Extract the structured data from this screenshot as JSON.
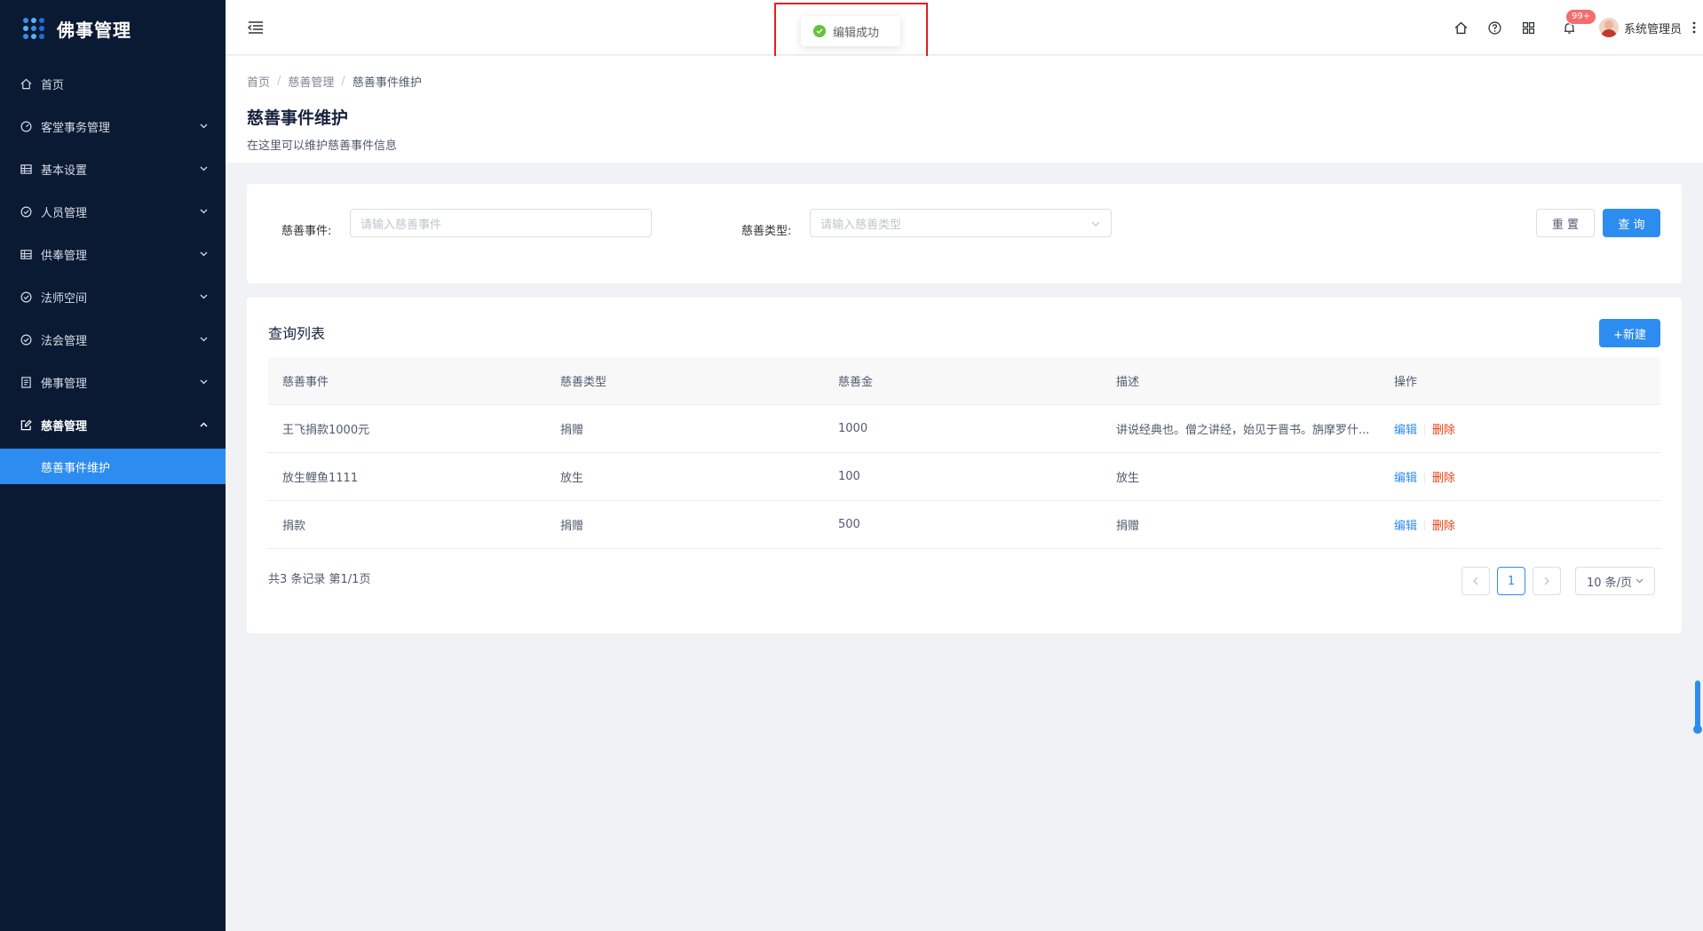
{
  "app": {
    "title": "佛事管理"
  },
  "sidebar": {
    "items": [
      {
        "label": "首页",
        "icon": "home-icon"
      },
      {
        "label": "客堂事务管理",
        "icon": "dashboard-icon"
      },
      {
        "label": "基本设置",
        "icon": "table-icon"
      },
      {
        "label": "人员管理",
        "icon": "check-circle-icon"
      },
      {
        "label": "供奉管理",
        "icon": "table-icon"
      },
      {
        "label": "法师空间",
        "icon": "check-circle-icon"
      },
      {
        "label": "法会管理",
        "icon": "check-circle-icon"
      },
      {
        "label": "佛事管理",
        "icon": "document-icon"
      },
      {
        "label": "慈善管理",
        "icon": "edit-icon"
      }
    ],
    "sub_item": "慈善事件维护"
  },
  "header": {
    "notification_badge": "99+",
    "user_name": "系统管理员"
  },
  "toast": {
    "message": "编辑成功",
    "color": "#67c23a"
  },
  "breadcrumb": [
    "首页",
    "慈善管理",
    "慈善事件维护"
  ],
  "page": {
    "title": "慈善事件维护",
    "description": "在这里可以维护慈善事件信息"
  },
  "search": {
    "event_label": "慈善事件:",
    "event_placeholder": "请输入慈善事件",
    "type_label": "慈善类型:",
    "type_placeholder": "请输入慈善类型",
    "reset_label": "重 置",
    "query_label": "查 询"
  },
  "list": {
    "title": "查询列表",
    "new_label": "+新建",
    "columns": [
      "慈善事件",
      "慈善类型",
      "慈善金",
      "描述",
      "操作"
    ],
    "rows": [
      {
        "event": "王飞捐款1000元",
        "type": "捐赠",
        "amount": "1000",
        "desc": "讲说经典也。僧之讲经，始见于晋书。旃摩罗什...",
        "edit": "编辑",
        "delete": "删除"
      },
      {
        "event": "放生鲤鱼1111",
        "type": "放生",
        "amount": "100",
        "desc": "放生",
        "edit": "编辑",
        "delete": "删除"
      },
      {
        "event": "捐款",
        "type": "捐赠",
        "amount": "500",
        "desc": "捐赠",
        "edit": "编辑",
        "delete": "删除"
      }
    ],
    "total_text": "共3 条记录 第1/1页",
    "current_page": "1",
    "page_size": "10 条/页"
  },
  "colors": {
    "sidebar_bg": "#0b1a33",
    "primary": "#2d8cf0",
    "danger": "#ed4014",
    "badge": "#f56c6c"
  }
}
